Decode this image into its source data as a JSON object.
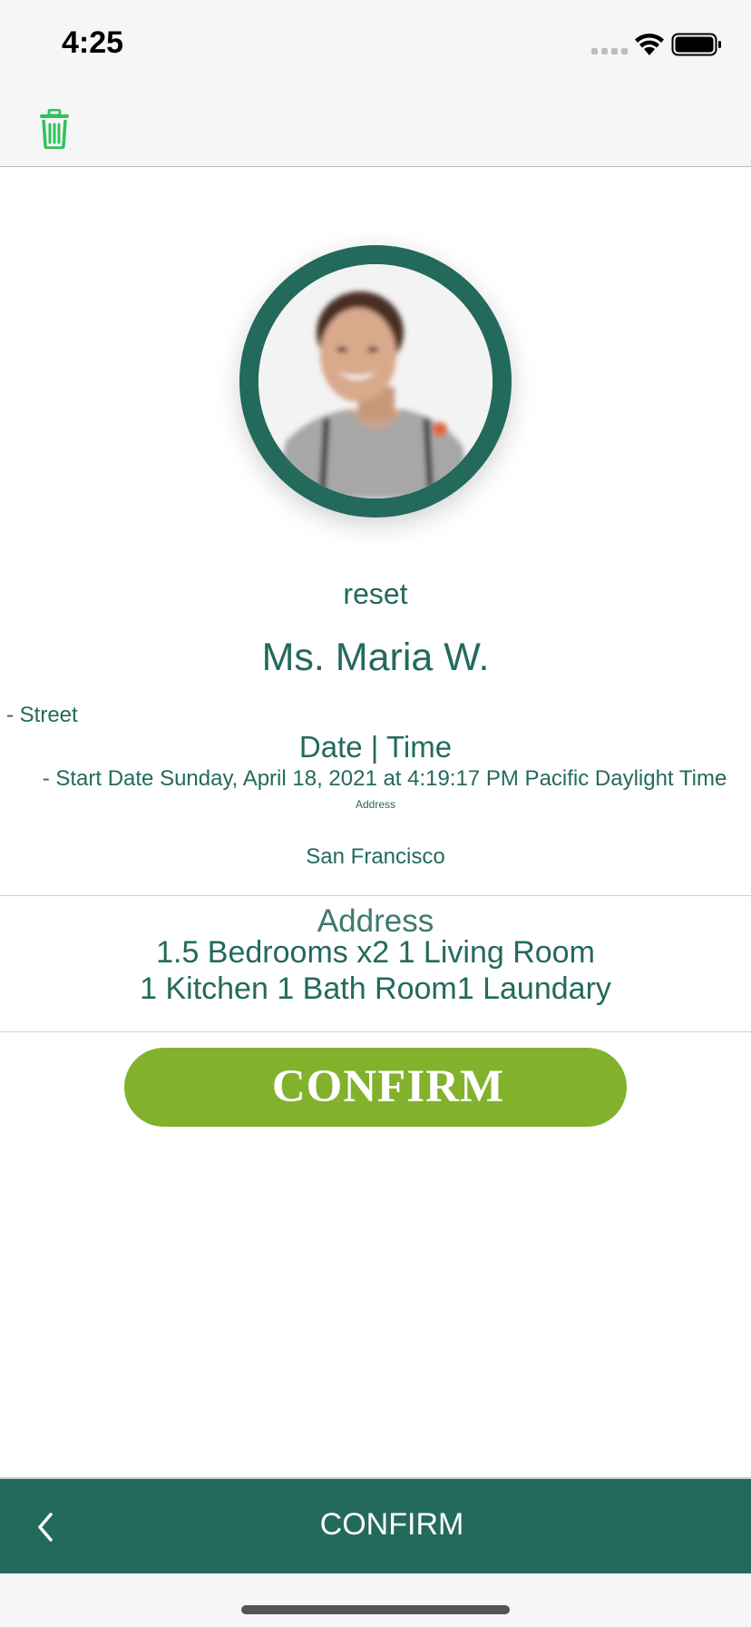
{
  "status_bar": {
    "time": "4:25"
  },
  "nav": {
    "delete_icon": "trash-icon"
  },
  "profile": {
    "reset_label": "reset",
    "name": "Ms. Maria W."
  },
  "details": {
    "street": "- Street",
    "datetime_label": "Date | Time",
    "start_date": "- Start Date Sunday, April 18, 2021 at 4:19:17 PM Pacific Daylight Time",
    "address_small": "Address",
    "city": "San Francisco"
  },
  "rooms": {
    "heading": "Address",
    "line1": "1.5 Bedrooms x2  1 Living Room",
    "line2": "1 Kitchen  1 Bath Room1 Laundary"
  },
  "actions": {
    "confirm_label": "CONFIRM"
  },
  "bottom_bar": {
    "title": "CONFIRM",
    "back_icon": "chevron-left-icon"
  },
  "colors": {
    "primary": "#236a5c",
    "accent_green": "#82b22b",
    "trash_green": "#2fc35a"
  }
}
